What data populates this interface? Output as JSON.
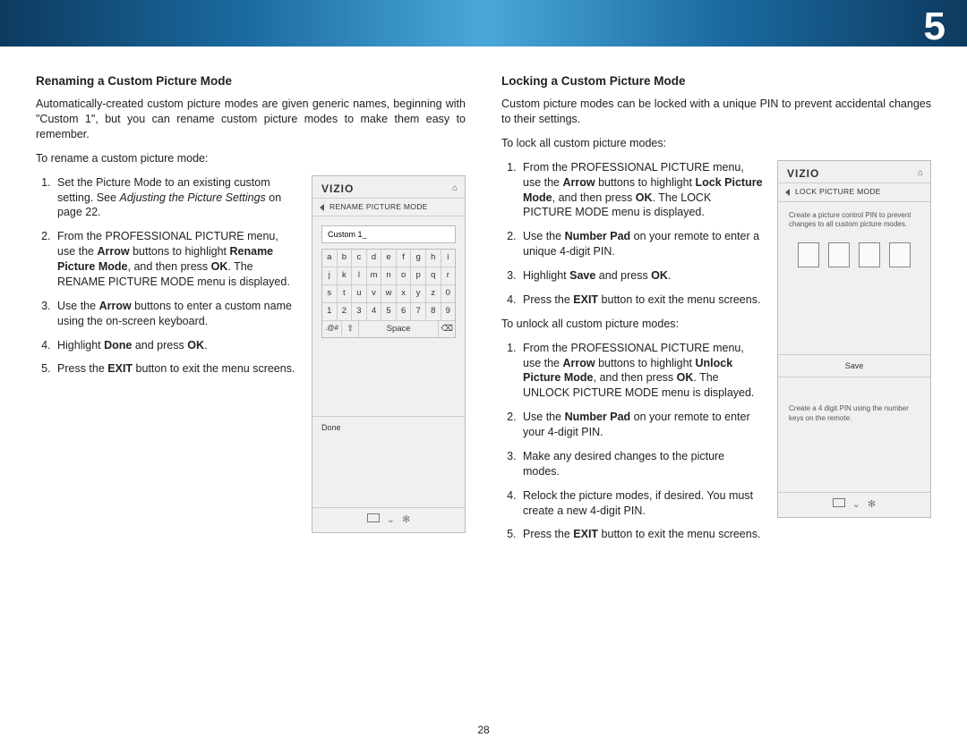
{
  "chapter_number": "5",
  "page_number": "28",
  "left": {
    "heading": "Renaming a Custom Picture Mode",
    "intro": "Automatically-created custom picture modes are given generic names, beginning with \"Custom 1\", but you can rename custom picture modes to make them easy to remember.",
    "lead_in": "To rename a custom picture mode:",
    "steps": {
      "s1a": "Set the Picture Mode to an existing custom setting. See ",
      "s1b": "Adjusting the Picture Settings",
      "s1c": " on page 22.",
      "s2a": "From the PROFESSIONAL PICTURE menu, use the ",
      "s2b": "Arrow",
      "s2c": " buttons to highlight ",
      "s2d": "Rename Picture Mode",
      "s2e": ", and then press ",
      "s2f": "OK",
      "s2g": ". The RENAME PICTURE MODE menu is displayed.",
      "s3a": "Use the ",
      "s3b": "Arrow",
      "s3c": " buttons to enter a custom name using the on-screen keyboard.",
      "s4a": "Highlight ",
      "s4b": "Done",
      "s4c": " and press ",
      "s4d": "OK",
      "s4e": ".",
      "s5a": "Press the ",
      "s5b": "EXIT",
      "s5c": " button to exit the menu screens."
    },
    "osd": {
      "brand": "VIZIO",
      "subhead": "RENAME PICTURE MODE",
      "field_value": "Custom 1_",
      "kbd_rows": [
        [
          "a",
          "b",
          "c",
          "d",
          "e",
          "f",
          "g",
          "h",
          "i"
        ],
        [
          "j",
          "k",
          "l",
          "m",
          "n",
          "o",
          "p",
          "q",
          "r"
        ],
        [
          "s",
          "t",
          "u",
          "v",
          "w",
          "x",
          "y",
          "z",
          "0"
        ],
        [
          "1",
          "2",
          "3",
          "4",
          "5",
          "6",
          "7",
          "8",
          "9"
        ]
      ],
      "kbd_sym": ".@#",
      "kbd_shift": "⇧",
      "kbd_space": "Space",
      "kbd_back": "⌫",
      "done": "Done"
    }
  },
  "right": {
    "heading": "Locking a Custom Picture Mode",
    "intro": "Custom picture modes can be locked with a unique PIN to prevent accidental changes to their settings.",
    "lock_lead_in": "To lock all custom picture modes:",
    "lock": {
      "s1a": "From the PROFESSIONAL PICTURE menu, use the ",
      "s1b": "Arrow",
      "s1c": " buttons to highlight ",
      "s1d": "Lock Picture Mode",
      "s1e": ", and then press ",
      "s1f": "OK",
      "s1g": ". The LOCK PICTURE MODE menu is displayed.",
      "s2a": "Use the ",
      "s2b": "Number Pad",
      "s2c": " on your remote to enter a unique 4-digit PIN.",
      "s3a": "Highlight ",
      "s3b": "Save",
      "s3c": " and press ",
      "s3d": "OK",
      "s3e": ".",
      "s4a": "Press the ",
      "s4b": "EXIT",
      "s4c": " button to exit the menu screens."
    },
    "unlock_lead_in": "To unlock all custom picture modes:",
    "unlock": {
      "s1a": "From the PROFESSIONAL PICTURE menu, use the ",
      "s1b": "Arrow",
      "s1c": " buttons to highlight ",
      "s1d": "Unlock Picture Mode",
      "s1e": ", and then press ",
      "s1f": "OK",
      "s1g": ". The UNLOCK PICTURE MODE menu is displayed.",
      "s2a": "Use the ",
      "s2b": "Number Pad",
      "s2c": " on your remote to enter your 4-digit PIN.",
      "s3": "Make any desired changes to the picture modes.",
      "s4": "Relock the picture modes, if desired. You must create a new 4-digit PIN.",
      "s5a": "Press the ",
      "s5b": "EXIT",
      "s5c": " button to exit the menu screens."
    },
    "osd": {
      "brand": "VIZIO",
      "subhead": "LOCK PICTURE MODE",
      "info_top": "Create a picture control PIN to prevent changes to all custom picture modes.",
      "save": "Save",
      "info_bottom": "Create a 4 digit PIN using the number keys on the remote."
    }
  }
}
